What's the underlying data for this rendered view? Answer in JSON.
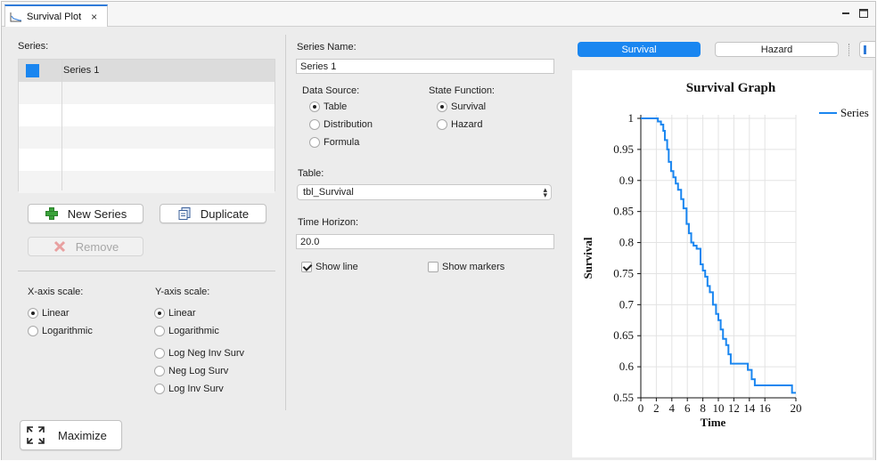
{
  "tab": {
    "title": "Survival Plot",
    "close_glyph": "×"
  },
  "series_panel": {
    "label": "Series:",
    "items": [
      {
        "name": "Series 1",
        "color": "#1a86f0"
      }
    ],
    "new_series_label": "New Series",
    "duplicate_label": "Duplicate",
    "remove_label": "Remove"
  },
  "axes": {
    "x_label": "X-axis scale:",
    "x_options": [
      "Linear",
      "Logarithmic"
    ],
    "x_selected": "Linear",
    "y_label": "Y-axis scale:",
    "y_options": [
      "Linear",
      "Logarithmic",
      "Log Neg Inv Surv",
      "Neg Log Surv",
      "Log Inv Surv"
    ],
    "y_selected": "Linear"
  },
  "maximize_label": "Maximize",
  "form": {
    "series_name_label": "Series Name:",
    "series_name_value": "Series 1",
    "data_source_label": "Data Source:",
    "data_source_options": [
      "Table",
      "Distribution",
      "Formula"
    ],
    "data_source_selected": "Table",
    "state_function_label": "State Function:",
    "state_function_options": [
      "Survival",
      "Hazard"
    ],
    "state_function_selected": "Survival",
    "table_label": "Table:",
    "table_value": "tbl_Survival",
    "time_horizon_label": "Time Horizon:",
    "time_horizon_value": "20.0",
    "show_line_label": "Show line",
    "show_line_checked": true,
    "show_markers_label": "Show markers",
    "show_markers_checked": false
  },
  "view_toggle": {
    "survival_label": "Survival",
    "hazard_label": "Hazard",
    "selected": "Survival"
  },
  "chart_data": {
    "type": "line",
    "title": "Survival Graph",
    "xlabel": "Time",
    "ylabel": "Survival",
    "xlim": [
      0,
      20
    ],
    "ylim": [
      0.55,
      1
    ],
    "xticks": [
      "0",
      "2",
      "4",
      "6",
      "8",
      "10",
      "12",
      "14",
      "16",
      "20"
    ],
    "xtick_values": [
      0,
      2,
      4,
      6,
      8,
      10,
      12,
      14,
      16,
      20
    ],
    "yticks": [
      "0.55",
      "0.6",
      "0.65",
      "0.7",
      "0.75",
      "0.8",
      "0.85",
      "0.9",
      "0.95",
      "1"
    ],
    "ytick_values": [
      0.55,
      0.6,
      0.65,
      0.7,
      0.75,
      0.8,
      0.85,
      0.9,
      0.95,
      1
    ],
    "grid": true,
    "legend": "top-right",
    "series": [
      {
        "name": "Series",
        "color": "#1a86f0",
        "step": true,
        "x": [
          0,
          2.2,
          2.6,
          2.9,
          3.1,
          3.4,
          3.6,
          3.9,
          4.2,
          4.5,
          4.8,
          5.2,
          5.5,
          5.9,
          6.2,
          6.5,
          6.8,
          7.2,
          7.7,
          8.0,
          8.3,
          8.6,
          8.9,
          9.3,
          9.7,
          10.0,
          10.3,
          10.6,
          11.0,
          11.3,
          11.6,
          12.0,
          13.8,
          14.3,
          14.7,
          19.5,
          20.0
        ],
        "y": [
          1.0,
          0.995,
          0.99,
          0.98,
          0.965,
          0.95,
          0.93,
          0.915,
          0.905,
          0.895,
          0.885,
          0.87,
          0.855,
          0.83,
          0.815,
          0.8,
          0.795,
          0.79,
          0.765,
          0.755,
          0.745,
          0.73,
          0.72,
          0.7,
          0.685,
          0.675,
          0.66,
          0.645,
          0.635,
          0.62,
          0.605,
          0.605,
          0.595,
          0.58,
          0.57,
          0.558,
          0.558
        ]
      }
    ]
  }
}
